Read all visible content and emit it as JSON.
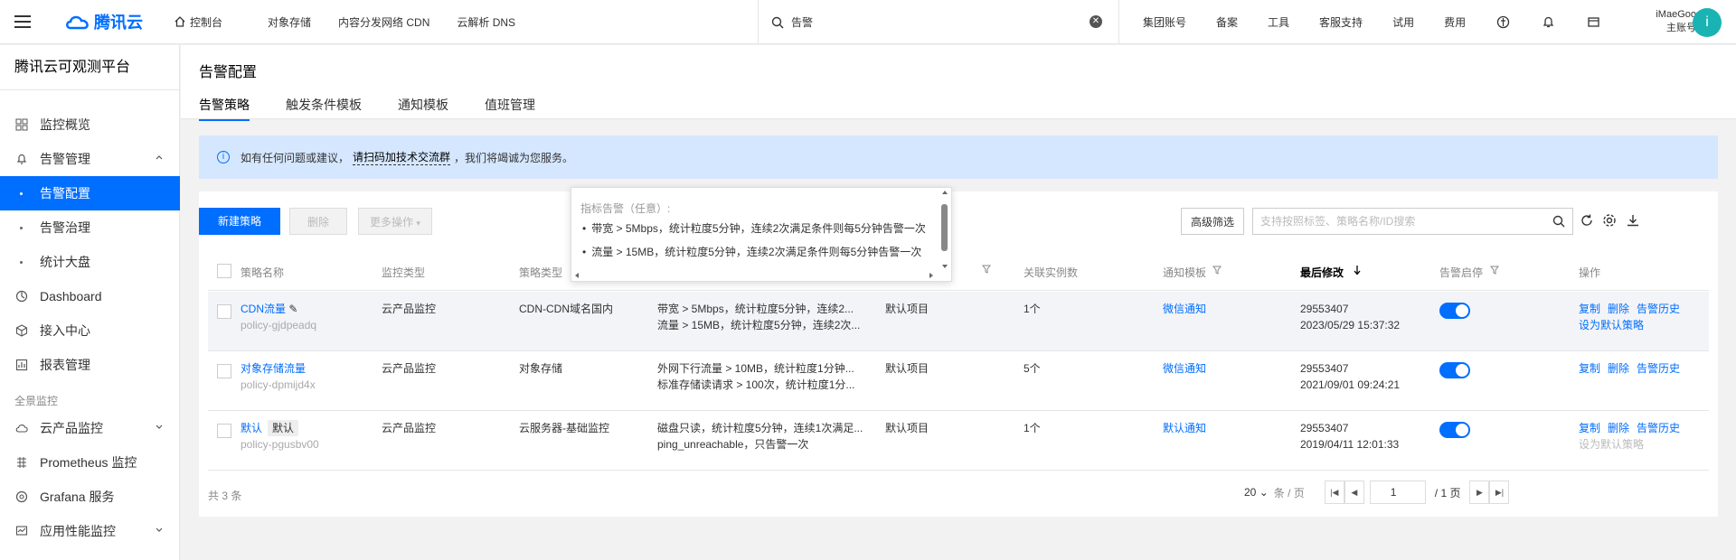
{
  "topbar": {
    "brand": "腾讯云",
    "console": "控制台",
    "nav": [
      "对象存储",
      "内容分发网络 CDN",
      "云解析 DNS"
    ],
    "search_value": "告警",
    "right_links": [
      "集团账号",
      "备案",
      "工具",
      "客服支持",
      "试用",
      "费用"
    ],
    "account_name": "iMaeGoo",
    "account_role": "主账号",
    "avatar_letter": "i"
  },
  "sidebar": {
    "title": "腾讯云可观测平台",
    "items": [
      {
        "label": "监控概览"
      },
      {
        "label": "告警管理"
      },
      {
        "label": "告警配置"
      },
      {
        "label": "告警治理"
      },
      {
        "label": "统计大盘"
      },
      {
        "label": "Dashboard"
      },
      {
        "label": "接入中心"
      },
      {
        "label": "报表管理"
      }
    ],
    "group_label": "全景监控",
    "group_items": [
      {
        "label": "云产品监控"
      },
      {
        "label": "Prometheus 监控"
      },
      {
        "label": "Grafana 服务"
      },
      {
        "label": "应用性能监控"
      }
    ]
  },
  "page": {
    "title": "告警配置",
    "tabs": [
      "告警策略",
      "触发条件模板",
      "通知模板",
      "值班管理"
    ]
  },
  "notice": {
    "prefix": "如有任何问题或建议，",
    "link": "请扫码加技术交流群",
    "suffix": "，我们将竭诚为您服务。"
  },
  "toolbar": {
    "create": "新建策略",
    "delete": "删除",
    "more": "更多操作",
    "advanced": "高级筛选",
    "search_placeholder": "支持按照标签、策略名称/ID搜索"
  },
  "table": {
    "headers": [
      "策略名称",
      "监控类型",
      "策略类型",
      "",
      "",
      "关联实例数",
      "通知模板",
      "最后修改",
      "告警启停",
      "操作"
    ],
    "rows": [
      {
        "name": "CDN流量",
        "id": "policy-gjdpeadq",
        "monitor_type": "云产品监控",
        "policy_type": "CDN-CDN域名国内",
        "cond1": "带宽 > 5Mbps，统计粒度5分钟，连续2...",
        "cond2": "流量 > 15MB，统计粒度5分钟，连续2次...",
        "project": "默认项目",
        "instances": "1个",
        "notify": "微信通知",
        "modifier": "29553407",
        "time": "2023/05/29 15:37:32",
        "ops": [
          "复制",
          "删除",
          "告警历史"
        ],
        "op2": "设为默认策略"
      },
      {
        "name": "对象存储流量",
        "id": "policy-dpmijd4x",
        "monitor_type": "云产品监控",
        "policy_type": "对象存储",
        "cond1": "外网下行流量 > 10MB，统计粒度1分钟...",
        "cond2": "标准存储读请求 > 100次，统计粒度1分...",
        "project": "默认项目",
        "instances": "5个",
        "notify": "微信通知",
        "modifier": "29553407",
        "time": "2021/09/01 09:24:21",
        "ops": [
          "复制",
          "删除",
          "告警历史"
        ]
      },
      {
        "name": "默认",
        "tag": "默认",
        "id": "policy-pgusbv00",
        "monitor_type": "云产品监控",
        "policy_type": "云服务器-基础监控",
        "cond1": "磁盘只读，统计粒度5分钟，连续1次满足...",
        "cond2": "ping_unreachable，只告警一次",
        "project": "默认项目",
        "instances": "1个",
        "notify": "默认通知",
        "modifier": "29553407",
        "time": "2019/04/11 12:01:33",
        "ops": [
          "复制",
          "删除",
          "告警历史"
        ],
        "op2": "设为默认策略"
      }
    ],
    "total": "共 3 条",
    "page_size": "20",
    "page_size_unit": "条 / 页",
    "page_current": "1",
    "page_total": "/ 1 页"
  },
  "tooltip": {
    "title": "指标告警（任意）:",
    "lines": [
      "带宽 > 5Mbps，统计粒度5分钟，连续2次满足条件则每5分钟告警一次",
      "流量 > 15MB，统计粒度5分钟，连续2次满足条件则每5分钟告警一次"
    ]
  }
}
